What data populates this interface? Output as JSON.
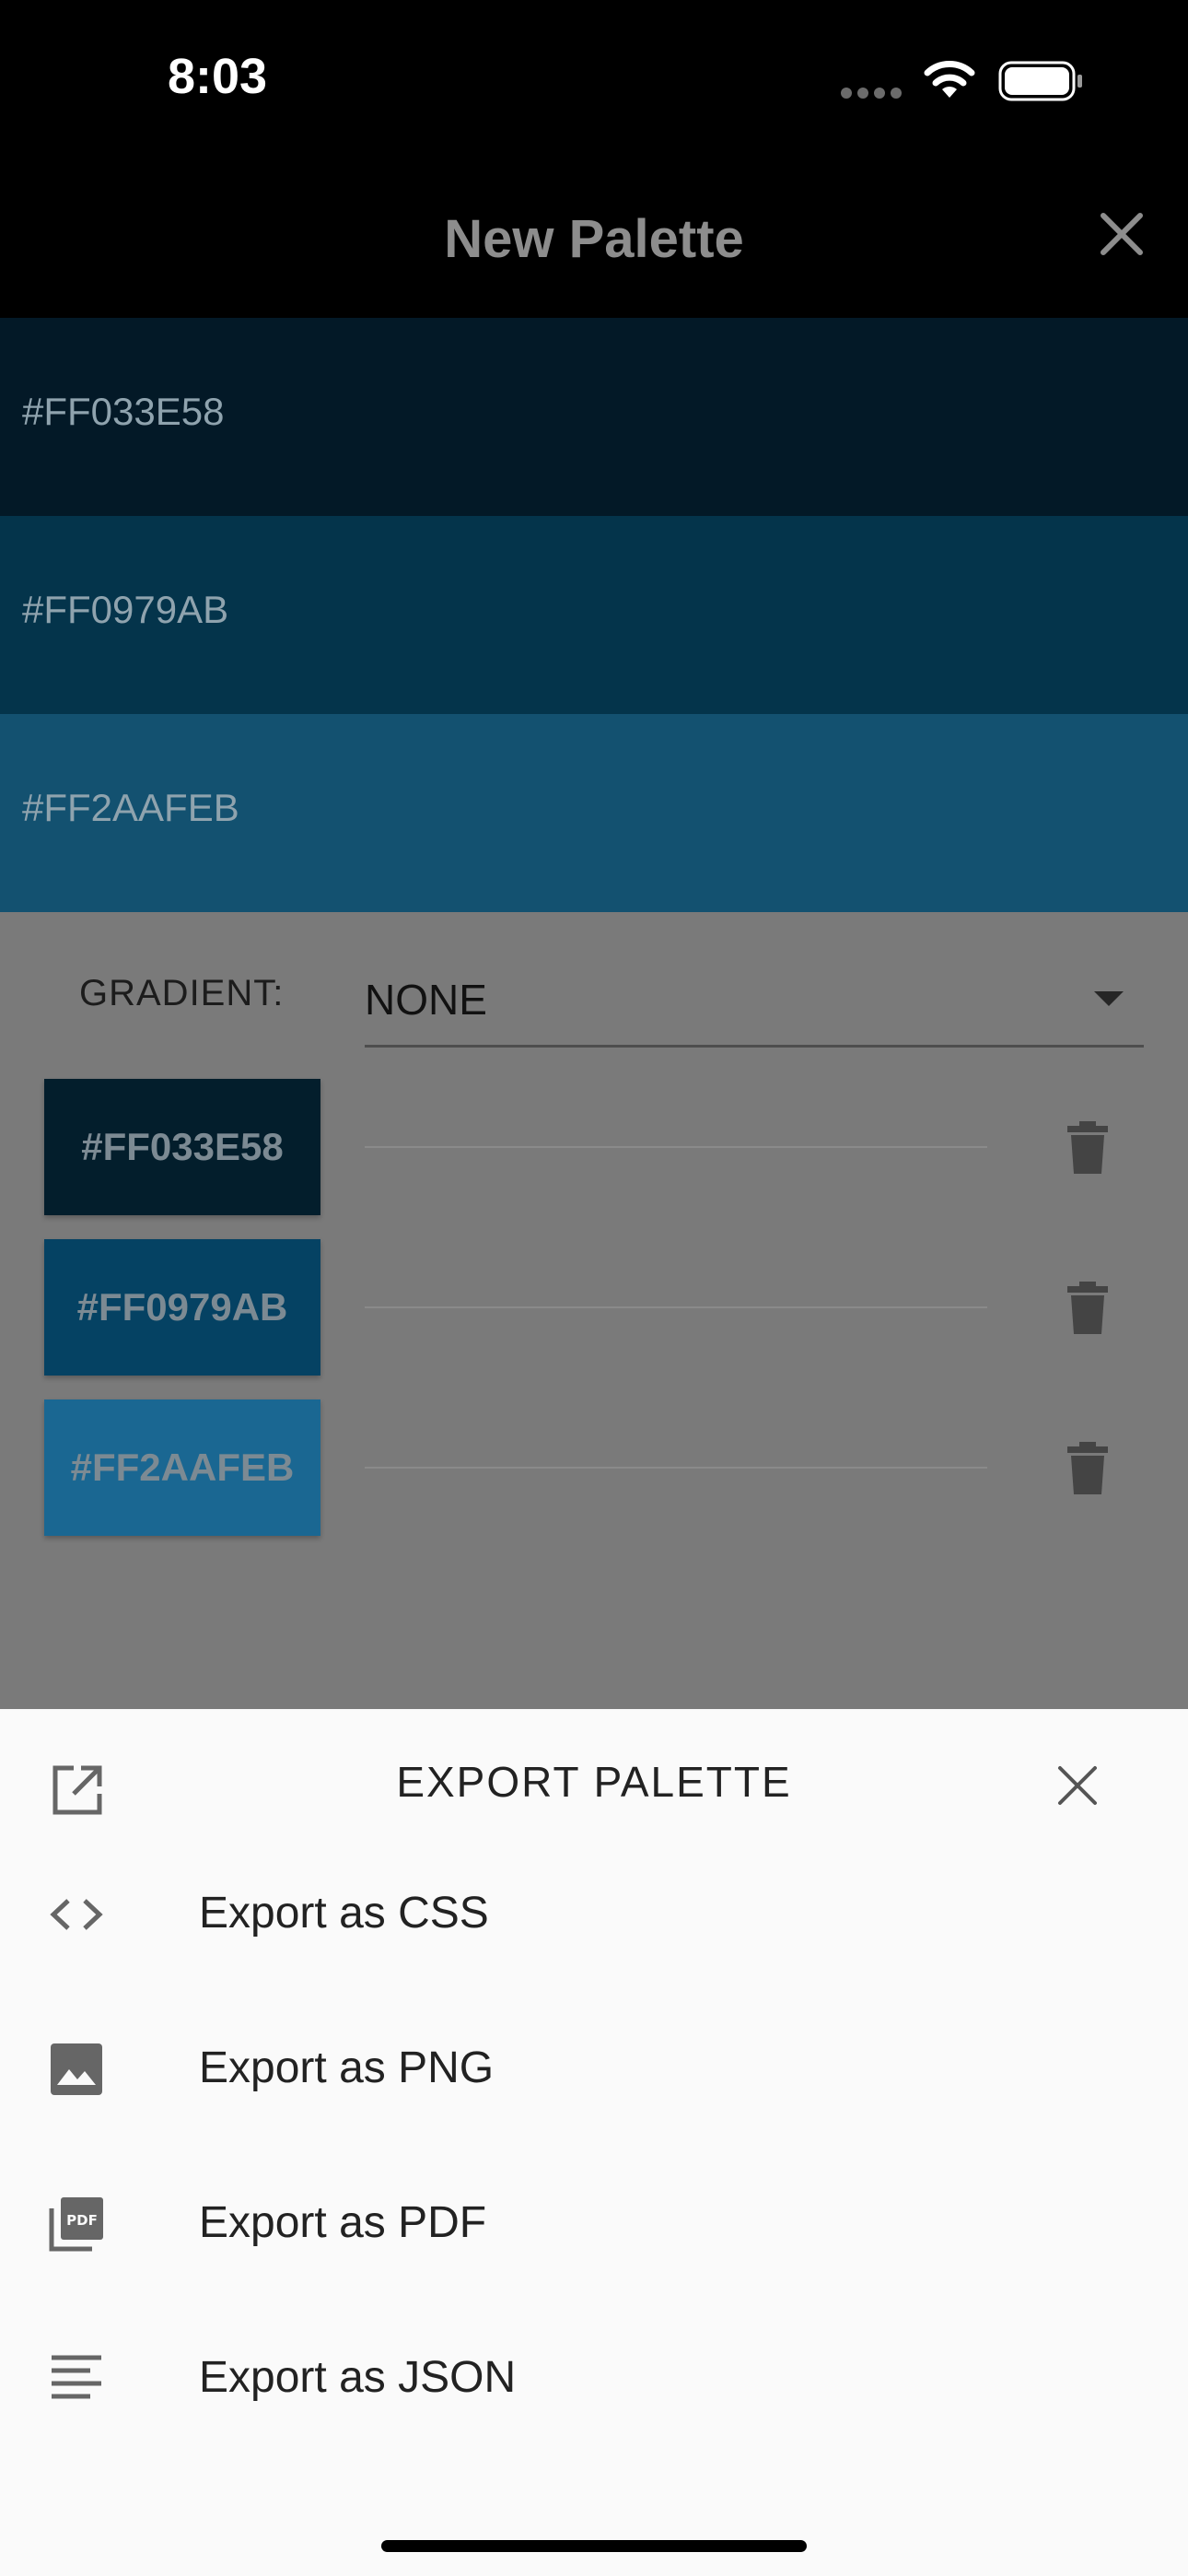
{
  "status_bar": {
    "time": "8:03"
  },
  "app_bar": {
    "title": "New Palette",
    "close_icon": "close-icon"
  },
  "preview_swatches": [
    {
      "hex": "#FF033E58",
      "color": "#031927"
    },
    {
      "hex": "#FF0979AB",
      "color": "#04344b"
    },
    {
      "hex": "#FF2AAFEB",
      "color": "#135170"
    }
  ],
  "gradient": {
    "label": "GRADIENT:",
    "value": "NONE"
  },
  "color_rows": [
    {
      "hex": "#FF033E58",
      "color": "#031e2c"
    },
    {
      "hex": "#FF0979AB",
      "color": "#054263"
    },
    {
      "hex": "#FF2AAFEB",
      "color": "#1a6792"
    }
  ],
  "export_sheet": {
    "title": "EXPORT PALETTE",
    "items": [
      {
        "label": "Export as CSS",
        "icon": "code-icon"
      },
      {
        "label": "Export as PNG",
        "icon": "image-icon"
      },
      {
        "label": "Export as PDF",
        "icon": "pdf-icon"
      },
      {
        "label": "Export as JSON",
        "icon": "text-lines-icon"
      }
    ]
  }
}
